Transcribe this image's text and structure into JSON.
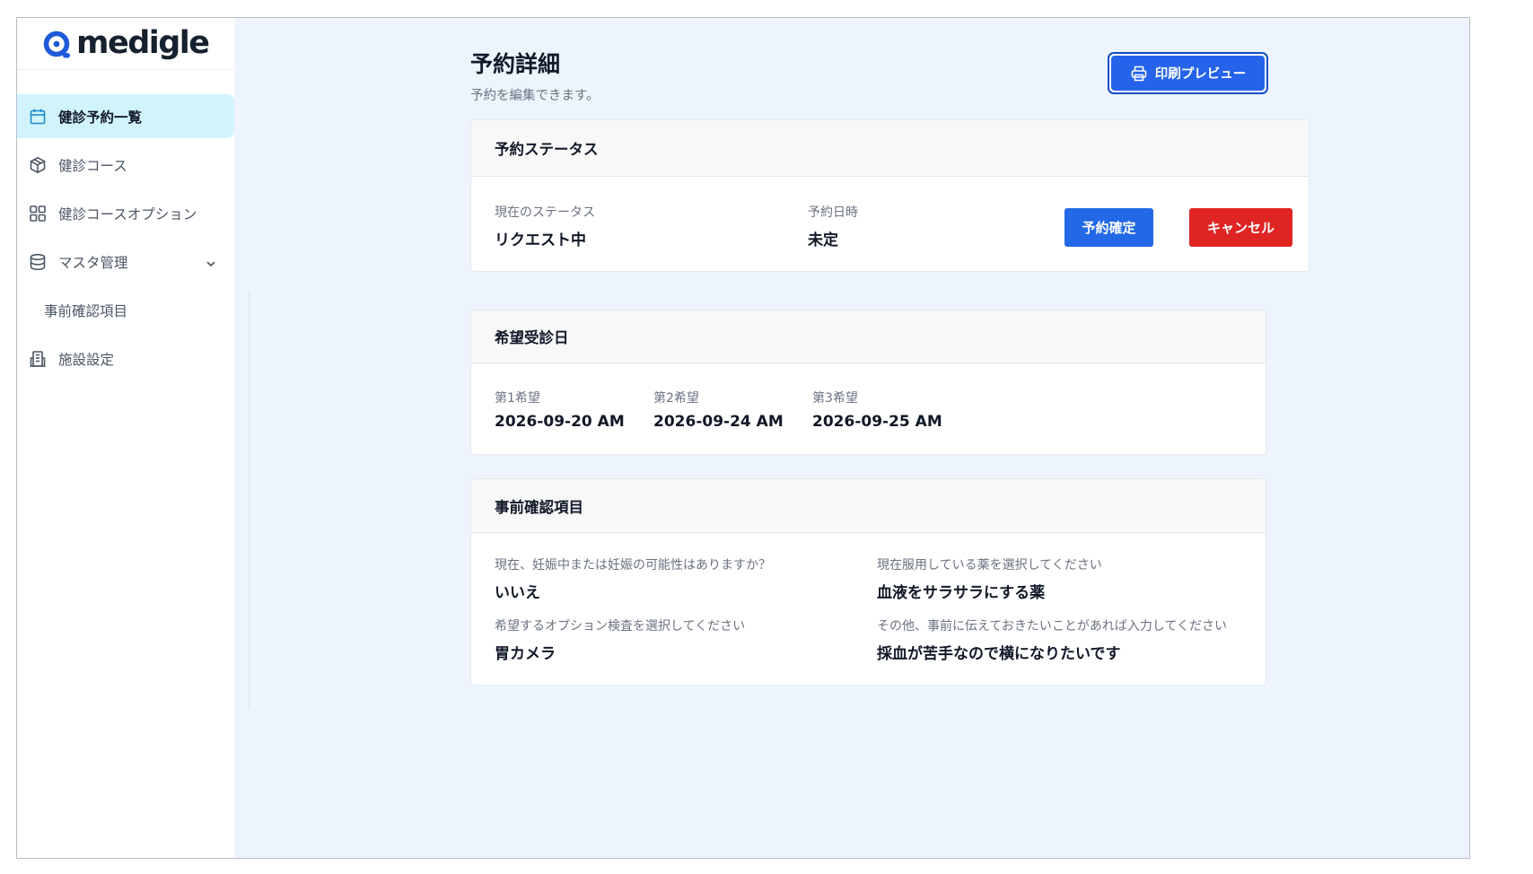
{
  "brand": {
    "name": "medigle"
  },
  "sidebar": {
    "items": [
      {
        "label": "健診予約一覧",
        "icon": "calendar-icon",
        "active": true
      },
      {
        "label": "健診コース",
        "icon": "package-icon"
      },
      {
        "label": "健診コースオプション",
        "icon": "grid-icon"
      },
      {
        "label": "マスタ管理",
        "icon": "database-icon",
        "expandable": true
      },
      {
        "label": "事前確認項目",
        "sub": true
      },
      {
        "label": "施設設定",
        "icon": "building-icon"
      }
    ]
  },
  "header": {
    "title": "予約詳細",
    "subtitle": "予約を編集できます。",
    "print_label": "印刷プレビュー"
  },
  "status_card": {
    "title": "予約ステータス",
    "status_label": "現在のステータス",
    "status_value": "リクエスト中",
    "datetime_label": "予約日時",
    "datetime_value": "未定",
    "confirm_label": "予約確定",
    "cancel_label": "キャンセル"
  },
  "preferred_card": {
    "title": "希望受診日",
    "choices": [
      {
        "label": "第1希望",
        "value": "2026-09-20 AM"
      },
      {
        "label": "第2希望",
        "value": "2026-09-24 AM"
      },
      {
        "label": "第3希望",
        "value": "2026-09-25 AM"
      }
    ]
  },
  "precheck_card": {
    "title": "事前確認項目",
    "items": [
      {
        "question": "現在、妊娠中または妊娠の可能性はありますか？",
        "answer": "いいえ"
      },
      {
        "question": "現在服用している薬を選択してください",
        "answer": "血液をサラサラにする薬"
      },
      {
        "question": "希望するオプション検査を選択してください",
        "answer": "胃カメラ"
      },
      {
        "question": "その他、事前に伝えておきたいことがあれば入力してください",
        "answer": "採血が苦手なので横になりたいです"
      }
    ]
  },
  "colors": {
    "accent": "#2368e6",
    "danger": "#df2424",
    "active_nav_bg": "#d1f4fc",
    "page_bg": "#eef4fd"
  }
}
